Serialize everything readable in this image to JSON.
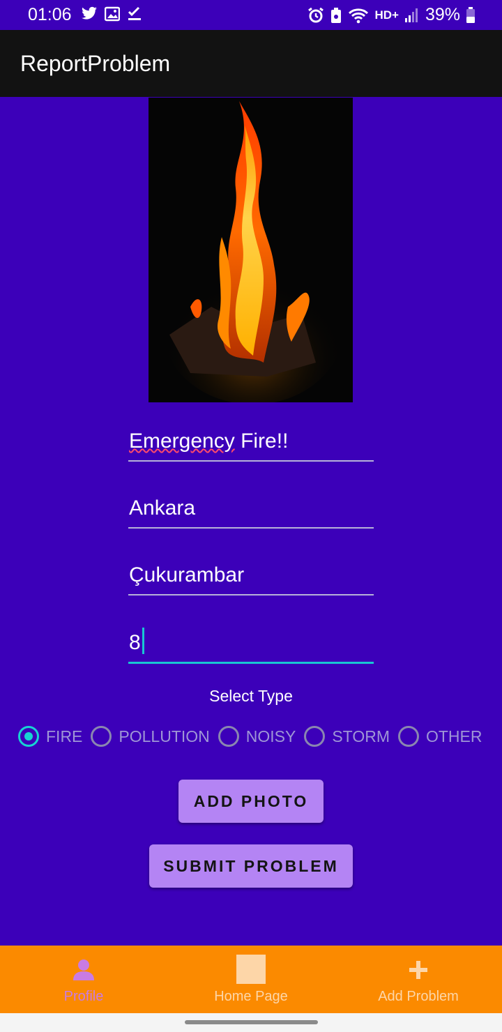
{
  "status_bar": {
    "time": "01:06",
    "battery": "39%",
    "network": "HD+",
    "icons_left": [
      "twitter-icon",
      "gallery-icon",
      "checkmark-icon"
    ],
    "icons_right": [
      "alarm-icon",
      "battery-saver-icon",
      "wifi-icon",
      "signal-icon",
      "battery-icon"
    ]
  },
  "app_bar": {
    "title": "ReportProblem"
  },
  "form": {
    "title_value_part1": "Emergency",
    "title_value_part2": " Fire!!",
    "city_value": "Ankara",
    "district_value": "Çukurambar",
    "number_value": "8"
  },
  "select_type": {
    "label": "Select Type",
    "options": [
      "FIRE",
      "POLLUTION",
      "NOISY",
      "STORM",
      "OTHER"
    ],
    "selected": "FIRE"
  },
  "buttons": {
    "add_photo": "ADD PHOTO",
    "submit": "SUBMIT PROBLEM"
  },
  "bottom_nav": {
    "items": [
      {
        "label": "Profile",
        "icon": "person-icon",
        "active": true
      },
      {
        "label": "Home Page",
        "icon": "home-icon",
        "active": false
      },
      {
        "label": "Add Problem",
        "icon": "plus-icon",
        "active": false
      }
    ]
  },
  "colors": {
    "background": "#3c00b9",
    "app_bar": "#121212",
    "accent": "#19c6d2",
    "button": "#b484f4",
    "bottom_nav": "#fb8a00"
  }
}
